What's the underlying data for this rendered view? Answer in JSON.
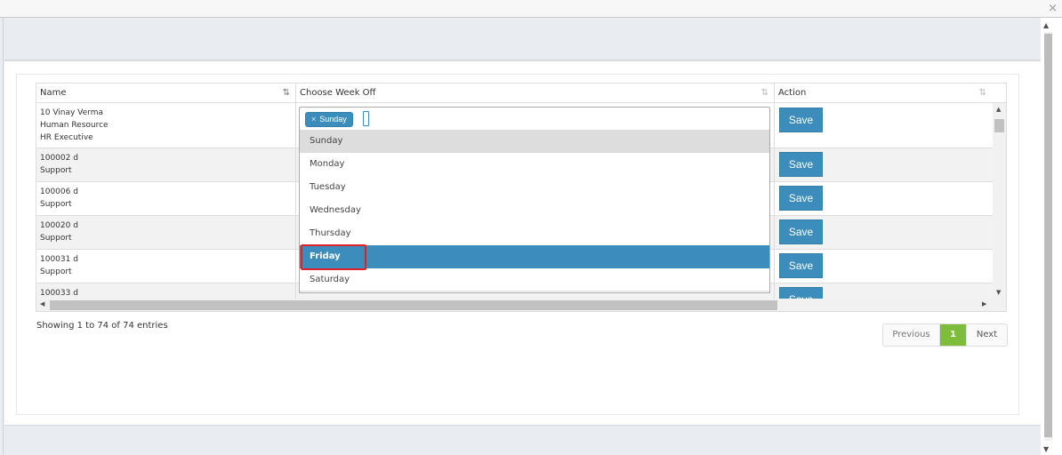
{
  "window": {
    "close_glyph": "×"
  },
  "table": {
    "headers": {
      "name": "Name",
      "week_off": "Choose Week Off",
      "action": "Action"
    },
    "rows": [
      {
        "lines": [
          "10 Vinay Verma",
          "Human Resource",
          "HR Executive"
        ],
        "action": "Save"
      },
      {
        "lines": [
          "100002 d",
          "Support"
        ],
        "action": "Save"
      },
      {
        "lines": [
          "100006 d",
          "Support"
        ],
        "action": "Save"
      },
      {
        "lines": [
          "100020 d",
          "Support"
        ],
        "action": "Save"
      },
      {
        "lines": [
          "100031 d",
          "Support"
        ],
        "action": "Save"
      },
      {
        "lines": [
          "100033 d",
          ""
        ],
        "action": "Save"
      }
    ]
  },
  "week_select": {
    "selected_tags": [
      {
        "label": "Sunday",
        "remove_glyph": "×"
      }
    ],
    "options": [
      {
        "label": "Sunday",
        "state": "selected"
      },
      {
        "label": "Monday",
        "state": "normal"
      },
      {
        "label": "Tuesday",
        "state": "normal"
      },
      {
        "label": "Wednesday",
        "state": "normal"
      },
      {
        "label": "Thursday",
        "state": "normal"
      },
      {
        "label": "Friday",
        "state": "highlighted"
      },
      {
        "label": "Saturday",
        "state": "normal"
      }
    ]
  },
  "footer": {
    "info": "Showing 1 to 74 of 74 entries",
    "pagination": {
      "previous": "Previous",
      "current": "1",
      "next": "Next"
    }
  },
  "colors": {
    "accent": "#3c8dbc",
    "pager_active": "#7dbd3b",
    "highlight_box": "#e0202a"
  },
  "icons": {
    "sort_active": "sort-asc-icon",
    "sort": "sort-icon"
  }
}
